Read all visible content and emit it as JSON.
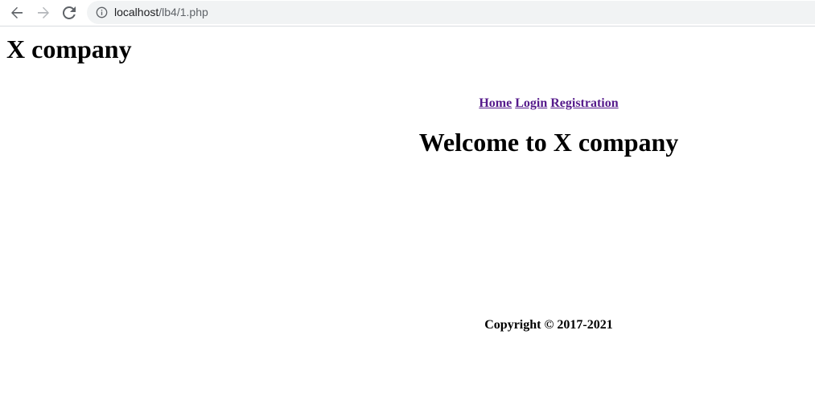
{
  "browser": {
    "url_host": "localhost",
    "url_path": "/lb4/1.php",
    "icons": {
      "back": "arrow-left-icon",
      "forward": "arrow-right-icon",
      "reload": "reload-icon",
      "site_info": "info-icon"
    }
  },
  "site": {
    "title": "X company"
  },
  "nav": {
    "home": "Home",
    "login": "Login",
    "registration": "Registration",
    "link_color": "#551a8b"
  },
  "main": {
    "heading": "Welcome to X company"
  },
  "footer": {
    "copyright": "Copyright © 2017-2021"
  }
}
